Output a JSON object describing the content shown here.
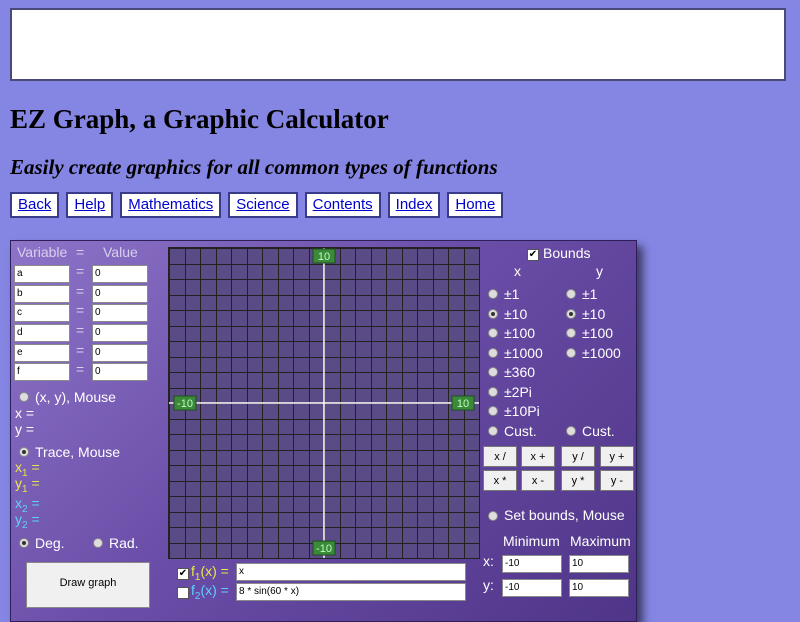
{
  "header": {
    "title": "EZ Graph, a Graphic Calculator",
    "subtitle": "Easily create graphics for all common types of functions"
  },
  "nav": {
    "items": [
      {
        "label": "Back"
      },
      {
        "label": "Help"
      },
      {
        "label": "Mathematics"
      },
      {
        "label": "Science"
      },
      {
        "label": "Contents"
      },
      {
        "label": "Index"
      },
      {
        "label": "Home"
      }
    ]
  },
  "variables": {
    "header_variable": "Variable",
    "header_eq": "=",
    "header_value": "Value",
    "rows": [
      {
        "name": "a",
        "eq": "=",
        "value": "0"
      },
      {
        "name": "b",
        "eq": "=",
        "value": "0"
      },
      {
        "name": "c",
        "eq": "=",
        "value": "0"
      },
      {
        "name": "d",
        "eq": "=",
        "value": "0"
      },
      {
        "name": "e",
        "eq": "=",
        "value": "0"
      },
      {
        "name": "f",
        "eq": "=",
        "value": "0"
      }
    ]
  },
  "mouse": {
    "xy_label": "(x, y), Mouse",
    "x_label": "x =",
    "y_label": "y =",
    "trace_label": "Trace, Mouse",
    "x1": "x",
    "y1": "y",
    "x2": "x",
    "y2": "y",
    "sub1": "1",
    "sub2": "2",
    "eq": " ="
  },
  "angle": {
    "deg": "Deg.",
    "rad": "Rad."
  },
  "draw_button": "Draw graph",
  "graph": {
    "top_label": "10",
    "bottom_label": "-10",
    "left_label": "-10",
    "right_label": "10",
    "divisions": 20
  },
  "functions": [
    {
      "label_main": "f",
      "label_sub": "1",
      "label_tail": "(x) =",
      "value": "x",
      "checked": true
    },
    {
      "label_main": "f",
      "label_sub": "2",
      "label_tail": "(x) =",
      "value": "8 * sin(60 * x)",
      "checked": false
    }
  ],
  "bounds": {
    "label": "Bounds",
    "x_header": "x",
    "y_header": "y",
    "x_options": [
      "±1",
      "±10",
      "±100",
      "±1000",
      "±360",
      "±2Pi",
      "±10Pi",
      "Cust."
    ],
    "y_options": [
      "±1",
      "±10",
      "±100",
      "±1000",
      "Cust."
    ],
    "x_selected": "±10",
    "y_selected": "±10"
  },
  "zoom_buttons": [
    "x /",
    "x +",
    "y /",
    "y +",
    "x *",
    "x -",
    "y *",
    "y -"
  ],
  "set_bounds_label": "Set bounds, Mouse",
  "minmax": {
    "min_header": "Minimum",
    "max_header": "Maximum",
    "x_label": "x:",
    "y_label": "y:",
    "x_min": "-10",
    "x_max": "10",
    "y_min": "-10",
    "y_max": "10"
  },
  "colors": {
    "background": "#8585e3",
    "f1": "#e8e84a",
    "f2": "#5ed0ff",
    "axis_label_bg": "#3a8a3a"
  }
}
